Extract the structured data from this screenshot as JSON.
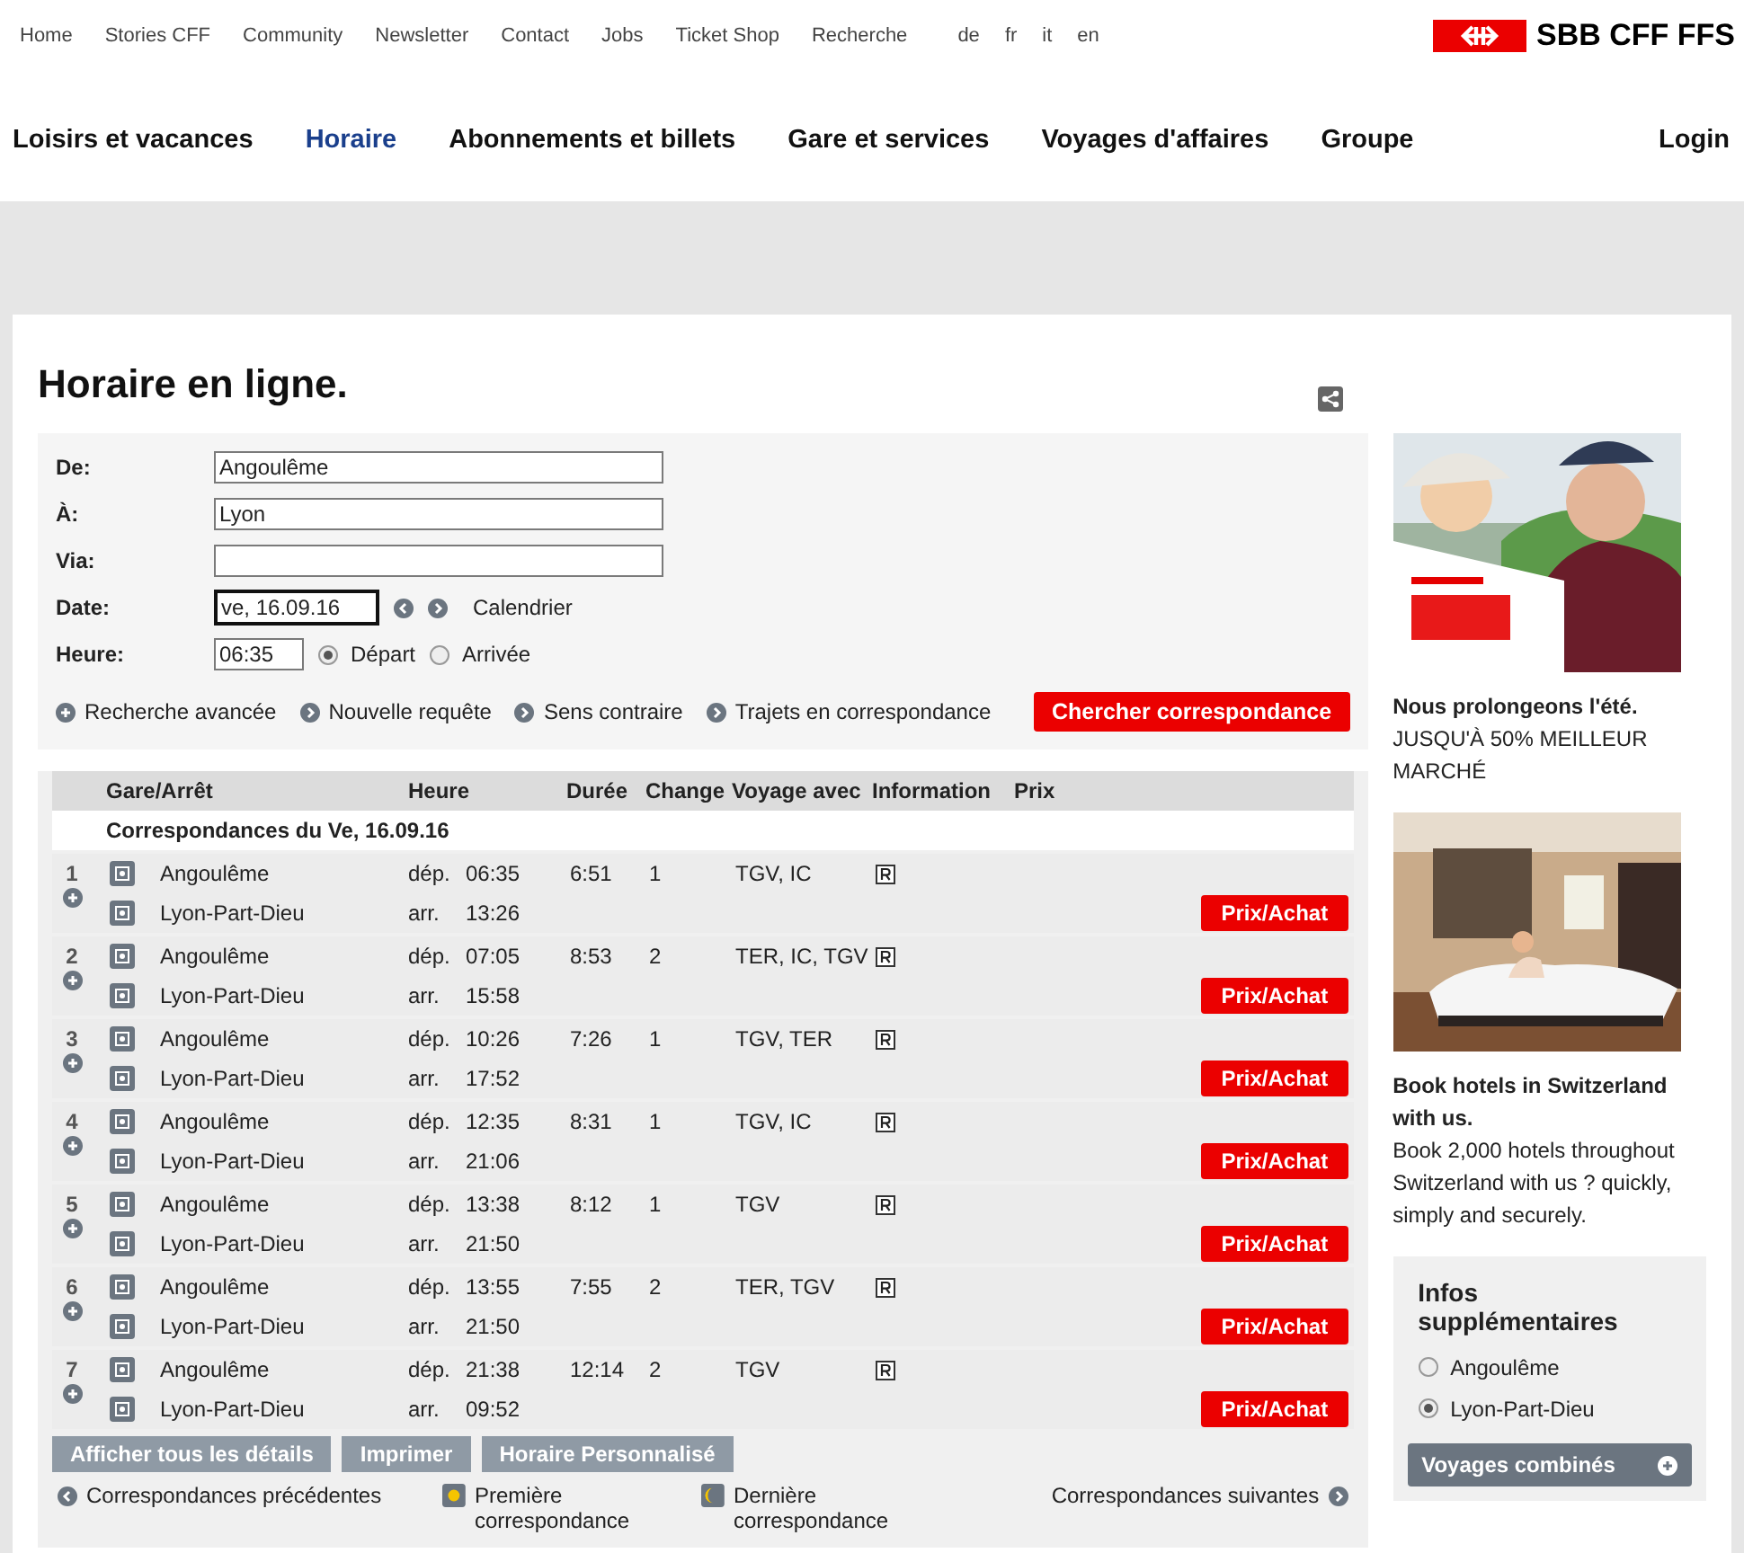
{
  "top_links": [
    "Home",
    "Stories CFF",
    "Community",
    "Newsletter",
    "Contact",
    "Jobs",
    "Ticket Shop",
    "Recherche"
  ],
  "languages": [
    "de",
    "fr",
    "it",
    "en"
  ],
  "logo": "SBB CFF FFS",
  "main_nav": [
    {
      "label": "Loisirs et vacances",
      "selected": false
    },
    {
      "label": "Horaire",
      "selected": true
    },
    {
      "label": "Abonnements et billets",
      "selected": false
    },
    {
      "label": "Gare et services",
      "selected": false
    },
    {
      "label": "Voyages d'affaires",
      "selected": false
    },
    {
      "label": "Groupe",
      "selected": false
    }
  ],
  "login": "Login",
  "title": "Horaire en ligne.",
  "form": {
    "fields": [
      {
        "label": "De:",
        "value": "Angoulême"
      },
      {
        "label": "À:",
        "value": "Lyon"
      },
      {
        "label": "Via:"
      }
    ],
    "date": {
      "label": "Date:",
      "value": "ve, 16.09.16",
      "calendar": "Calendrier"
    },
    "time": {
      "label": "Heure:",
      "value": "06:35",
      "options": [
        {
          "label": "Départ",
          "selected": true
        },
        {
          "label": "Arrivée",
          "selected": false
        }
      ]
    },
    "links": [
      "Recherche avancée",
      "Nouvelle requête",
      "Sens contraire",
      "Trajets en correspondance"
    ],
    "search_button": "Chercher correspondance"
  },
  "table": {
    "columns": [
      "Gare/Arrêt",
      "Heure",
      "Durée",
      "Change",
      "Voyage avec",
      "Information",
      "Prix"
    ],
    "date_header": "Correspondances du Ve, 16.09.16",
    "rows": [
      {
        "number": "1",
        "from": "Angoulême",
        "to": "Lyon-Part-Dieu",
        "dep_label": "dép.",
        "dep": "06:35",
        "arr_label": "arr.",
        "arr": "13:26",
        "duration": "6:51",
        "changes": "1",
        "products": "TGV, IC",
        "button": "Prix/Achat"
      },
      {
        "number": "2",
        "from": "Angoulême",
        "to": "Lyon-Part-Dieu",
        "dep_label": "dép.",
        "dep": "07:05",
        "arr_label": "arr.",
        "arr": "15:58",
        "duration": "8:53",
        "changes": "2",
        "products": "TER, IC, TGV",
        "button": "Prix/Achat"
      },
      {
        "number": "3",
        "from": "Angoulême",
        "to": "Lyon-Part-Dieu",
        "dep_label": "dép.",
        "dep": "10:26",
        "arr_label": "arr.",
        "arr": "17:52",
        "duration": "7:26",
        "changes": "1",
        "products": "TGV, TER",
        "button": "Prix/Achat"
      },
      {
        "number": "4",
        "from": "Angoulême",
        "to": "Lyon-Part-Dieu",
        "dep_label": "dép.",
        "dep": "12:35",
        "arr_label": "arr.",
        "arr": "21:06",
        "duration": "8:31",
        "changes": "1",
        "products": "TGV, IC",
        "button": "Prix/Achat"
      },
      {
        "number": "5",
        "from": "Angoulême",
        "to": "Lyon-Part-Dieu",
        "dep_label": "dép.",
        "dep": "13:38",
        "arr_label": "arr.",
        "arr": "21:50",
        "duration": "8:12",
        "changes": "1",
        "products": "TGV",
        "button": "Prix/Achat"
      },
      {
        "number": "6",
        "from": "Angoulême",
        "to": "Lyon-Part-Dieu",
        "dep_label": "dép.",
        "dep": "13:55",
        "arr_label": "arr.",
        "arr": "21:50",
        "duration": "7:55",
        "changes": "2",
        "products": "TER, TGV",
        "button": "Prix/Achat"
      },
      {
        "number": "7",
        "from": "Angoulême",
        "to": "Lyon-Part-Dieu",
        "dep_label": "dép.",
        "dep": "21:38",
        "arr_label": "arr.",
        "arr": "09:52",
        "duration": "12:14",
        "changes": "2",
        "products": "TGV",
        "button": "Prix/Achat"
      }
    ],
    "actions": [
      "Afficher tous les détails",
      "Imprimer",
      "Horaire Personnalisé"
    ],
    "previous": "Correspondances précédentes",
    "first": "Première correspondance",
    "last": "Dernière correspondance",
    "next": "Correspondances suivantes"
  },
  "sidebar": {
    "promos": [
      {
        "kind": "picture",
        "title": "Nous prolongeons l'été.",
        "text": "JUSQU'À 50% MEILLEUR MARCHÉ"
      },
      {
        "kind": "picture",
        "title": "Book hotels in Switzerland with us.",
        "text": "Book 2,000 hotels throughout Switzerland with us ? quickly, simply and securely."
      }
    ],
    "infos": {
      "title": "Infos supplémentaires",
      "stations": [
        {
          "label": "Angoulême",
          "selected": false
        },
        {
          "label": "Lyon-Part-Dieu",
          "selected": true
        }
      ],
      "buttons": [
        "Voyages combinés"
      ]
    }
  }
}
